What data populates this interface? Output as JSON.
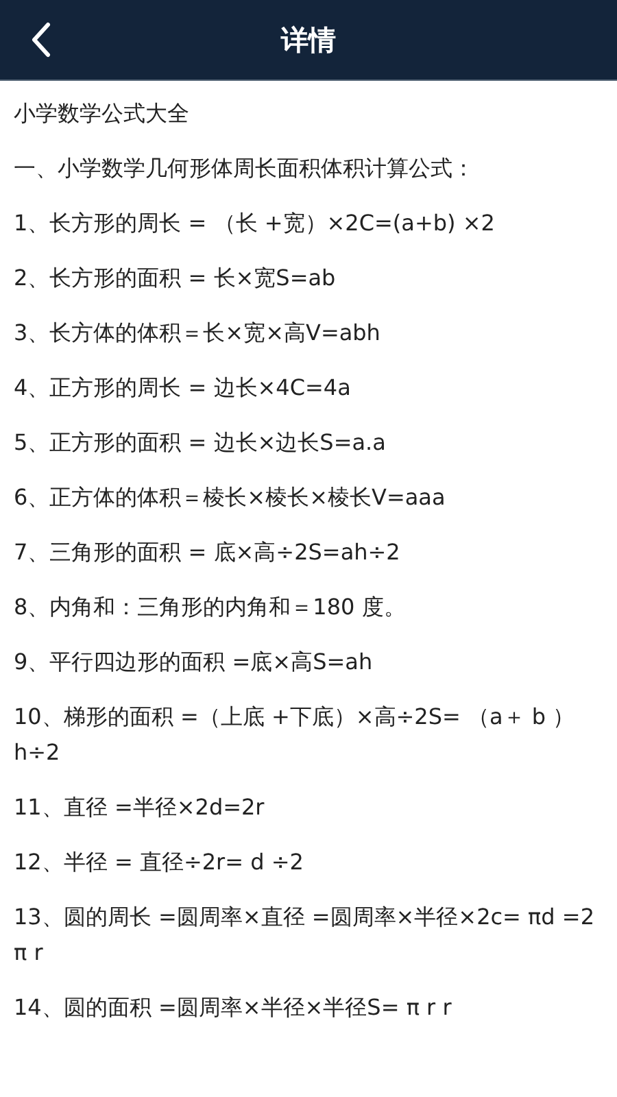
{
  "header": {
    "title": "详情"
  },
  "article": {
    "title": "小学数学公式大全",
    "paragraphs": [
      "一、小学数学几何形体周长面积体积计算公式：",
      "1、长方形的周长 = （长 +宽）×2C=(a+b) ×2",
      "2、长方形的面积 = 长×宽S=ab",
      "3、长方体的体积＝长×宽×高V=abh",
      "4、正方形的周长 = 边长×4C=4a",
      "5、正方形的面积 = 边长×边长S=a.a",
      "6、正方体的体积＝棱长×棱长×棱长V=aaa",
      "7、三角形的面积 = 底×高÷2S=ah÷2",
      "8、内角和：三角形的内角和＝180 度。",
      "9、平行四边形的面积 =底×高S=ah",
      "10、梯形的面积 =（上底 +下底）×高÷2S= （a＋ b ）h÷2",
      "11、直径 =半径×2d=2r",
      "12、半径 = 直径÷2r= d ÷2",
      "13、圆的周长 =圆周率×直径 =圆周率×半径×2c= πd =2 π r",
      "14、圆的面积 =圆周率×半径×半径S= π r r"
    ]
  }
}
